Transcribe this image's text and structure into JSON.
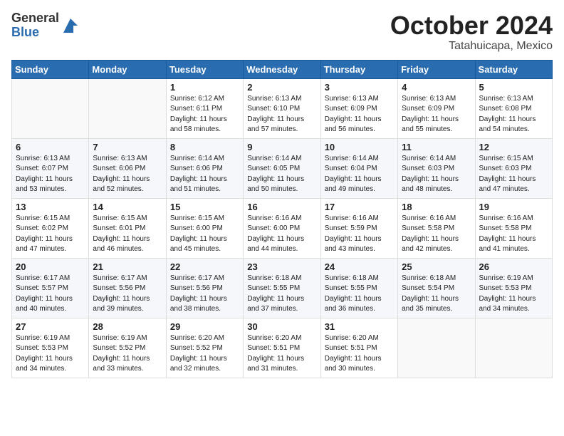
{
  "header": {
    "logo_general": "General",
    "logo_blue": "Blue",
    "month": "October 2024",
    "location": "Tatahuicapa, Mexico"
  },
  "days_of_week": [
    "Sunday",
    "Monday",
    "Tuesday",
    "Wednesday",
    "Thursday",
    "Friday",
    "Saturday"
  ],
  "weeks": [
    [
      {
        "day": "",
        "info": ""
      },
      {
        "day": "",
        "info": ""
      },
      {
        "day": "1",
        "info": "Sunrise: 6:12 AM\nSunset: 6:11 PM\nDaylight: 11 hours\nand 58 minutes."
      },
      {
        "day": "2",
        "info": "Sunrise: 6:13 AM\nSunset: 6:10 PM\nDaylight: 11 hours\nand 57 minutes."
      },
      {
        "day": "3",
        "info": "Sunrise: 6:13 AM\nSunset: 6:09 PM\nDaylight: 11 hours\nand 56 minutes."
      },
      {
        "day": "4",
        "info": "Sunrise: 6:13 AM\nSunset: 6:09 PM\nDaylight: 11 hours\nand 55 minutes."
      },
      {
        "day": "5",
        "info": "Sunrise: 6:13 AM\nSunset: 6:08 PM\nDaylight: 11 hours\nand 54 minutes."
      }
    ],
    [
      {
        "day": "6",
        "info": "Sunrise: 6:13 AM\nSunset: 6:07 PM\nDaylight: 11 hours\nand 53 minutes."
      },
      {
        "day": "7",
        "info": "Sunrise: 6:13 AM\nSunset: 6:06 PM\nDaylight: 11 hours\nand 52 minutes."
      },
      {
        "day": "8",
        "info": "Sunrise: 6:14 AM\nSunset: 6:06 PM\nDaylight: 11 hours\nand 51 minutes."
      },
      {
        "day": "9",
        "info": "Sunrise: 6:14 AM\nSunset: 6:05 PM\nDaylight: 11 hours\nand 50 minutes."
      },
      {
        "day": "10",
        "info": "Sunrise: 6:14 AM\nSunset: 6:04 PM\nDaylight: 11 hours\nand 49 minutes."
      },
      {
        "day": "11",
        "info": "Sunrise: 6:14 AM\nSunset: 6:03 PM\nDaylight: 11 hours\nand 48 minutes."
      },
      {
        "day": "12",
        "info": "Sunrise: 6:15 AM\nSunset: 6:03 PM\nDaylight: 11 hours\nand 47 minutes."
      }
    ],
    [
      {
        "day": "13",
        "info": "Sunrise: 6:15 AM\nSunset: 6:02 PM\nDaylight: 11 hours\nand 47 minutes."
      },
      {
        "day": "14",
        "info": "Sunrise: 6:15 AM\nSunset: 6:01 PM\nDaylight: 11 hours\nand 46 minutes."
      },
      {
        "day": "15",
        "info": "Sunrise: 6:15 AM\nSunset: 6:00 PM\nDaylight: 11 hours\nand 45 minutes."
      },
      {
        "day": "16",
        "info": "Sunrise: 6:16 AM\nSunset: 6:00 PM\nDaylight: 11 hours\nand 44 minutes."
      },
      {
        "day": "17",
        "info": "Sunrise: 6:16 AM\nSunset: 5:59 PM\nDaylight: 11 hours\nand 43 minutes."
      },
      {
        "day": "18",
        "info": "Sunrise: 6:16 AM\nSunset: 5:58 PM\nDaylight: 11 hours\nand 42 minutes."
      },
      {
        "day": "19",
        "info": "Sunrise: 6:16 AM\nSunset: 5:58 PM\nDaylight: 11 hours\nand 41 minutes."
      }
    ],
    [
      {
        "day": "20",
        "info": "Sunrise: 6:17 AM\nSunset: 5:57 PM\nDaylight: 11 hours\nand 40 minutes."
      },
      {
        "day": "21",
        "info": "Sunrise: 6:17 AM\nSunset: 5:56 PM\nDaylight: 11 hours\nand 39 minutes."
      },
      {
        "day": "22",
        "info": "Sunrise: 6:17 AM\nSunset: 5:56 PM\nDaylight: 11 hours\nand 38 minutes."
      },
      {
        "day": "23",
        "info": "Sunrise: 6:18 AM\nSunset: 5:55 PM\nDaylight: 11 hours\nand 37 minutes."
      },
      {
        "day": "24",
        "info": "Sunrise: 6:18 AM\nSunset: 5:55 PM\nDaylight: 11 hours\nand 36 minutes."
      },
      {
        "day": "25",
        "info": "Sunrise: 6:18 AM\nSunset: 5:54 PM\nDaylight: 11 hours\nand 35 minutes."
      },
      {
        "day": "26",
        "info": "Sunrise: 6:19 AM\nSunset: 5:53 PM\nDaylight: 11 hours\nand 34 minutes."
      }
    ],
    [
      {
        "day": "27",
        "info": "Sunrise: 6:19 AM\nSunset: 5:53 PM\nDaylight: 11 hours\nand 34 minutes."
      },
      {
        "day": "28",
        "info": "Sunrise: 6:19 AM\nSunset: 5:52 PM\nDaylight: 11 hours\nand 33 minutes."
      },
      {
        "day": "29",
        "info": "Sunrise: 6:20 AM\nSunset: 5:52 PM\nDaylight: 11 hours\nand 32 minutes."
      },
      {
        "day": "30",
        "info": "Sunrise: 6:20 AM\nSunset: 5:51 PM\nDaylight: 11 hours\nand 31 minutes."
      },
      {
        "day": "31",
        "info": "Sunrise: 6:20 AM\nSunset: 5:51 PM\nDaylight: 11 hours\nand 30 minutes."
      },
      {
        "day": "",
        "info": ""
      },
      {
        "day": "",
        "info": ""
      }
    ]
  ]
}
